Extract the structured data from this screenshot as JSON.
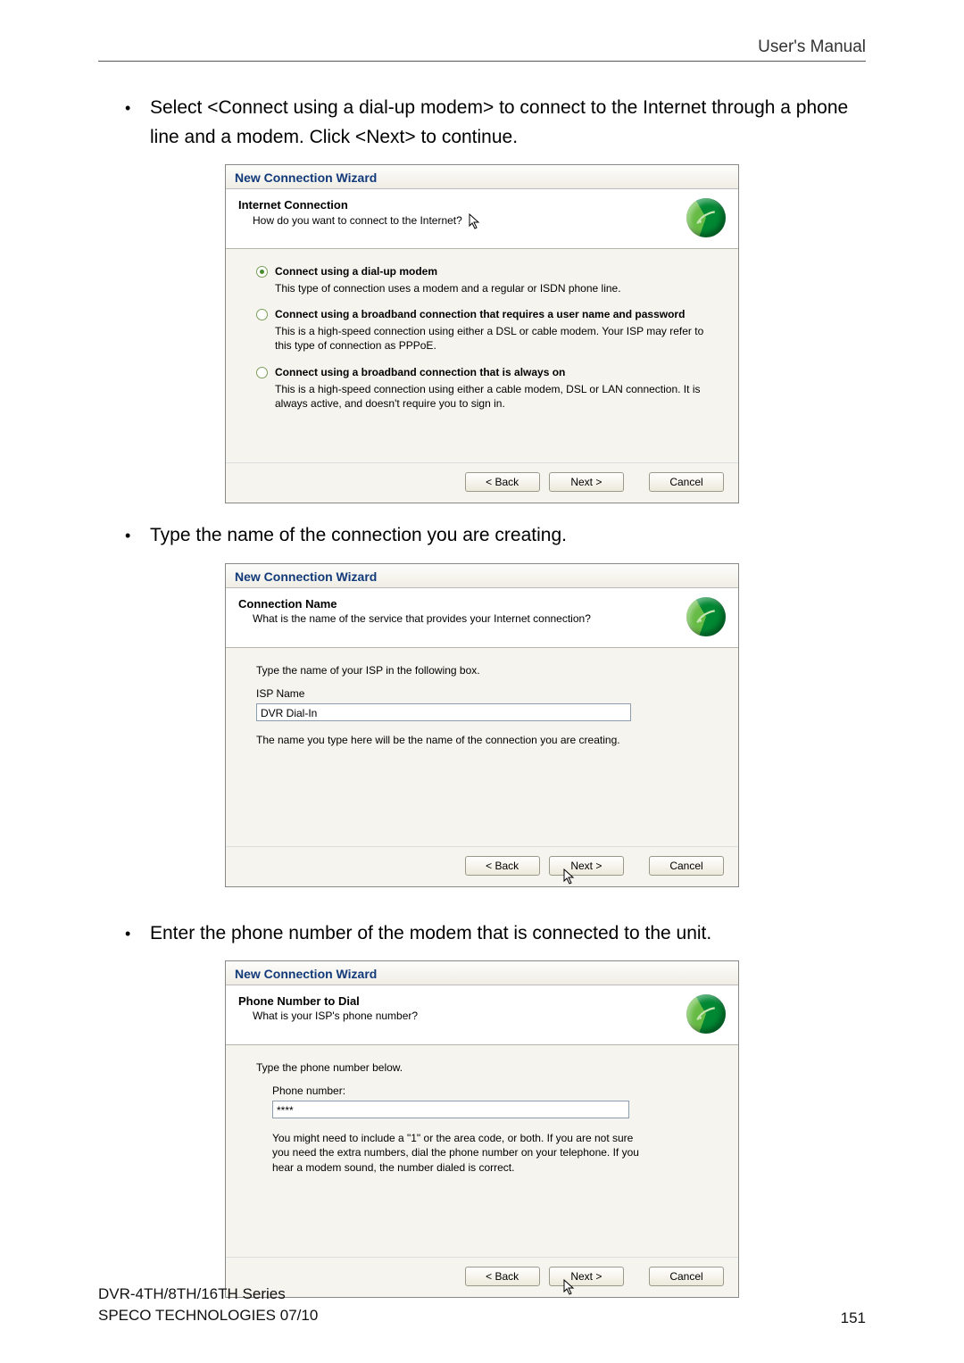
{
  "header": {
    "right": "User's Manual"
  },
  "bullets": {
    "b1": "Select <Connect using a dial-up modem> to connect to the Internet through a phone line and a modem. Click <Next> to continue.",
    "b2": "Type the name of the connection you are creating.",
    "b3": "Enter the phone number of the modem that is connected to the unit."
  },
  "wizard1": {
    "title": "New Connection Wizard",
    "heading": "Internet Connection",
    "sub": "How do you want to connect to the Internet?",
    "opt1_label": "Connect using a dial-up modem",
    "opt1_desc": "This type of connection uses a modem and a regular or ISDN phone line.",
    "opt2_label": "Connect using a broadband connection that requires a user name and password",
    "opt2_desc": "This is a high-speed connection using either a DSL or cable modem. Your ISP may refer to this type of connection as PPPoE.",
    "opt3_label": "Connect using a broadband connection that is always on",
    "opt3_desc": "This is a high-speed connection using either a cable modem, DSL or LAN connection. It is always active, and doesn't require you to sign in.",
    "back": "< Back",
    "next": "Next >",
    "cancel": "Cancel"
  },
  "wizard2": {
    "title": "New Connection Wizard",
    "heading": "Connection Name",
    "sub": "What is the name of the service that provides your Internet connection?",
    "instr": "Type the name of your ISP in the following box.",
    "field_label": "ISP Name",
    "field_value": "DVR Dial-In",
    "note": "The name you type here will be the name of the connection you are creating.",
    "back": "< Back",
    "next": "Next >",
    "cancel": "Cancel"
  },
  "wizard3": {
    "title": "New Connection Wizard",
    "heading": "Phone Number to Dial",
    "sub": "What is your ISP's phone number?",
    "instr": "Type the phone number below.",
    "field_label": "Phone number:",
    "field_value": "****",
    "note": "You might need to include a \"1\" or the area code, or both. If you are not sure you need the extra numbers, dial the phone number on your telephone. If you hear a modem sound, the number dialed is correct.",
    "back": "< Back",
    "next": "Next >",
    "cancel": "Cancel"
  },
  "footer": {
    "series": "DVR-4TH/8TH/16TH Series",
    "company": "SPECO TECHNOLOGIES 07/10",
    "page": "151"
  }
}
